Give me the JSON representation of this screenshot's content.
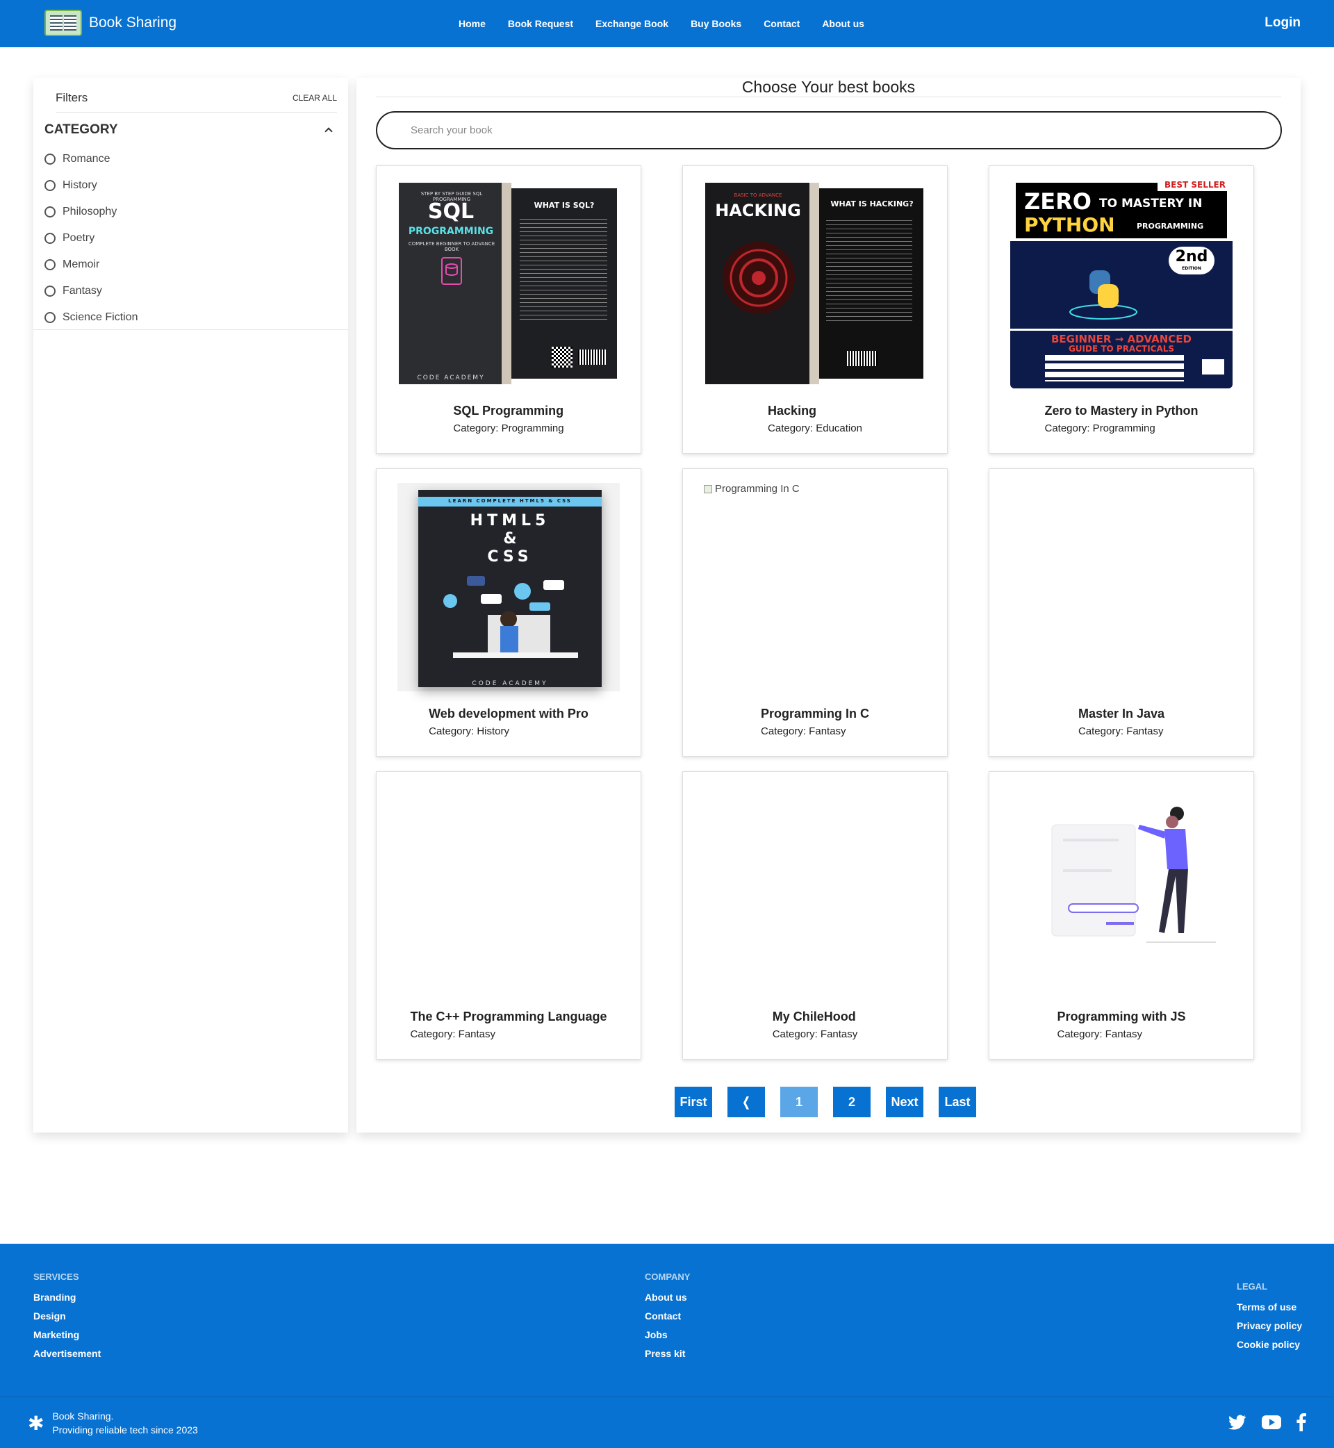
{
  "navbar": {
    "brand": "Book Sharing",
    "links": [
      "Home",
      "Book Request",
      "Exchange Book",
      "Buy Books",
      "Contact",
      "About us"
    ],
    "login": "Login",
    "color": "#0872d2"
  },
  "sidebar": {
    "filters_title": "Filters",
    "clear_all": "CLEAR ALL",
    "category_title": "CATEGORY",
    "categories": [
      "Romance",
      "History",
      "Philosophy",
      "Poetry",
      "Memoir",
      "Fantasy",
      "Science Fiction"
    ]
  },
  "main": {
    "title": "Choose Your best books",
    "search_placeholder": "Search your book",
    "books": [
      {
        "title": "SQL Programming",
        "category": "Category: Programming",
        "cover": "sql-cover"
      },
      {
        "title": "Hacking",
        "category": "Category: Education",
        "cover": "hacking-cover"
      },
      {
        "title": "Zero to Mastery in Python",
        "category": "Category: Programming",
        "cover": "python-cover"
      },
      {
        "title": "Web development with Pro",
        "category": "Category: History",
        "cover": "html-cover"
      },
      {
        "title": "Programming In C",
        "category": "Category: Fantasy",
        "cover": "broken",
        "alt": "Programming In C"
      },
      {
        "title": "Master In Java",
        "category": "Category: Fantasy",
        "cover": "none"
      },
      {
        "title": "The C++ Programming Language",
        "category": "Category: Fantasy",
        "cover": "none"
      },
      {
        "title": "My ChileHood",
        "category": "Category: Fantasy",
        "cover": "none"
      },
      {
        "title": "Programming with JS",
        "category": "Category: Fantasy",
        "cover": "illustration"
      }
    ],
    "covers": {
      "sql": {
        "line1": "SQL",
        "line2": "PROGRAMMING",
        "tag": "STEP BY STEP GUIDE SQL PROGRAMMING",
        "sub": "COMPLETE BEGINNER TO ADVANCE BOOK",
        "back_title": "WHAT IS SQL?",
        "publisher": "CODE ACADEMY"
      },
      "hacking": {
        "line0": "BASIC TO ADVANCE",
        "line1": "HACKING",
        "back_title": "WHAT IS HACKING?"
      },
      "python": {
        "badge": "BEST SELLER",
        "line1": "ZERO",
        "line1b": "TO MASTERY IN",
        "line2": "PYTHON",
        "line2b": "PROGRAMMING",
        "edition": "2nd",
        "edition_sub": "EDITION",
        "banner": "BEGINNER → ADVANCED",
        "banner2": "GUIDE TO PRACTICALS"
      },
      "html": {
        "top": "LEARN COMPLETE HTML5 & CSS",
        "line1": "HTML5",
        "line2": "&",
        "line3": "CSS",
        "publisher": "CODE ACADEMY"
      }
    }
  },
  "pagination": {
    "buttons": [
      "First",
      "❬",
      "1",
      "2",
      "Next",
      "Last"
    ],
    "active_index": 2
  },
  "footer": {
    "services_head": "SERVICES",
    "services": [
      "Branding",
      "Design",
      "Marketing",
      "Advertisement"
    ],
    "company_head": "COMPANY",
    "company": [
      "About us",
      "Contact",
      "Jobs",
      "Press kit"
    ],
    "legal_head": "LEGAL",
    "legal": [
      "Terms of use",
      "Privacy policy",
      "Cookie policy"
    ],
    "brand_line1": "Book Sharing.",
    "brand_line2": "Providing reliable tech since 2023",
    "social": [
      "twitter-icon",
      "youtube-icon",
      "facebook-icon"
    ]
  }
}
